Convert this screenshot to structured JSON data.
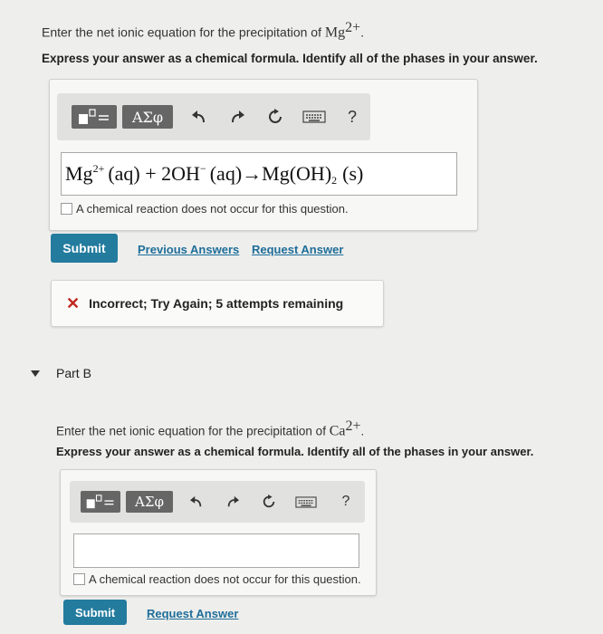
{
  "part_a": {
    "prompt_text": "Enter the net ionic equation for the precipitation of ",
    "prompt_ion": "Mg",
    "prompt_charge": "2+",
    "prompt_end": ".",
    "instruction": "Express your answer as a chemical formula. Identify all of the phases in your answer.",
    "toolbar": {
      "symbols_label": "ΑΣφ",
      "help_label": "?"
    },
    "answer": {
      "mg": "Mg",
      "mg_charge": "2+",
      "aq1": "(aq) + 2OH",
      "oh_charge": "−",
      "aq2": "(aq)→Mg(OH)",
      "sub2": "2",
      "solid": "(s)"
    },
    "no_reaction_label": "A chemical reaction does not occur for this question.",
    "submit_label": "Submit",
    "previous_answers_label": "Previous Answers",
    "request_answer_label": "Request Answer",
    "feedback": "Incorrect; Try Again; 5 attempts remaining"
  },
  "part_b": {
    "title": "Part B",
    "prompt_text": "Enter the net ionic equation for the precipitation of ",
    "prompt_ion": "Ca",
    "prompt_charge": "2+",
    "prompt_end": ".",
    "instruction": "Express your answer as a chemical formula. Identify all of the phases in your answer.",
    "toolbar": {
      "symbols_label": "ΑΣφ",
      "help_label": "?"
    },
    "answer_value": "",
    "no_reaction_label": "A chemical reaction does not occur for this question.",
    "submit_label": "Submit",
    "request_answer_label": "Request Answer"
  },
  "colors": {
    "accent": "#237b9e",
    "link": "#1e6e9a",
    "error": "#c0281e"
  }
}
